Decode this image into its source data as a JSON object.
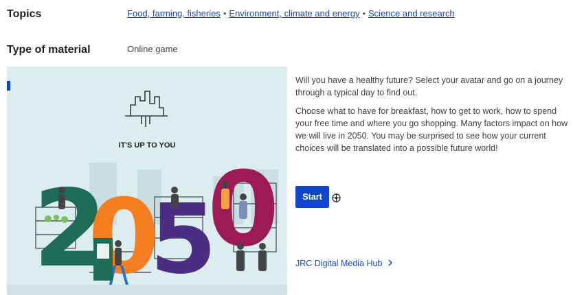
{
  "topics": {
    "label": "Topics",
    "items": [
      "Food, farming, fisheries",
      "Environment, climate and energy",
      "Science and research"
    ],
    "separator": "•"
  },
  "material": {
    "label": "Type of material",
    "value": "Online game"
  },
  "hero": {
    "tagline": "IT'S UP TO YOU",
    "digits": [
      "2",
      "0",
      "5",
      "0"
    ]
  },
  "description": {
    "p1": "Will you have a healthy future? Select your avatar and go on a journey through a typical day to find out.",
    "p2": "Choose what to have for breakfast, how to get to work, how to spend your free time and where you go shopping. Many factors impact on how we will live in 2050. You may be surprised to see how your current choices will be translated into a possible future world!"
  },
  "start_button": {
    "label": "Start"
  },
  "hub_link": {
    "label": "JRC Digital Media Hub"
  },
  "colors": {
    "accent": "#0e47cb",
    "hero_bg": "#dcedef",
    "digit_green": "#1e6b57",
    "digit_orange": "#f57f20",
    "digit_purple": "#4b2e83",
    "digit_magenta": "#9c1a55"
  },
  "icons": [
    "city-logo-icon",
    "cursor-icon",
    "chevron-right-icon"
  ]
}
